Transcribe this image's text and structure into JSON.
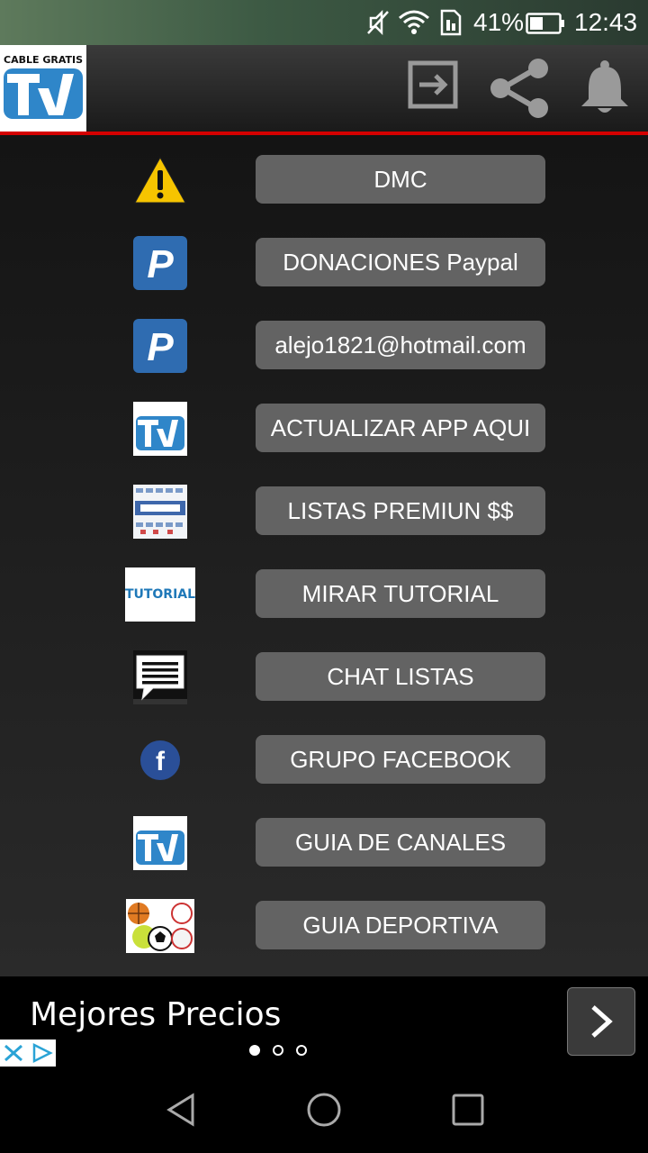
{
  "status_bar": {
    "battery_percent": "41%",
    "time": "12:43",
    "icons": [
      "mute-icon",
      "wifi-icon",
      "sim-icon",
      "battery-icon"
    ]
  },
  "app_bar": {
    "logo_text": "CABLE GRATIS",
    "actions": [
      "exit-icon",
      "share-icon",
      "bell-icon"
    ]
  },
  "menu": {
    "items": [
      {
        "label": "DMC",
        "icon": "warning-icon"
      },
      {
        "label": "DONACIONES Paypal",
        "icon": "paypal-icon"
      },
      {
        "label": "alejo1821@hotmail.com",
        "icon": "paypal-icon"
      },
      {
        "label": "ACTUALIZAR APP AQUI",
        "icon": "app-logo-icon"
      },
      {
        "label": "LISTAS PREMIUN $$",
        "icon": "andres-tv-icon"
      },
      {
        "label": "MIRAR TUTORIAL",
        "icon": "tutorial-icon",
        "icon_text": "TUTORIAL"
      },
      {
        "label": "CHAT LISTAS",
        "icon": "chat-icon"
      },
      {
        "label": "GRUPO FACEBOOK",
        "icon": "facebook-icon"
      },
      {
        "label": "GUIA DE CANALES",
        "icon": "app-logo-icon"
      },
      {
        "label": "GUIA DEPORTIVA",
        "icon": "sports-balls-icon"
      }
    ]
  },
  "ad_banner": {
    "text": "Mejores Precios",
    "page_count": 3,
    "active_page": 1
  },
  "nav_bar": {
    "buttons": [
      "back-icon",
      "home-icon",
      "recents-icon"
    ]
  },
  "colors": {
    "accent": "#d40000",
    "button_bg": "#636363",
    "content_bg": "#1f1f1f"
  }
}
